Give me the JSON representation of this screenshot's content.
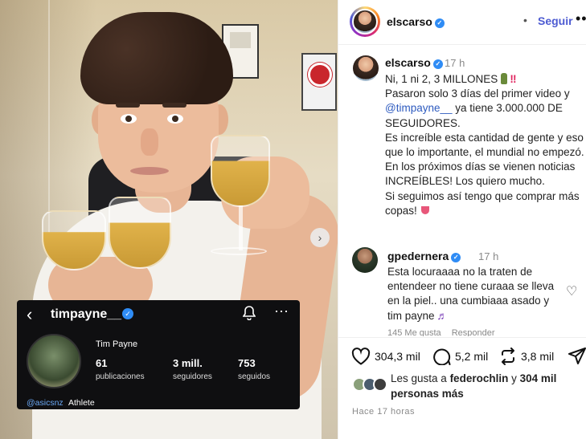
{
  "header": {
    "username": "elscarso",
    "follow_label": "Seguir",
    "more_label": "•••",
    "dot": "•"
  },
  "caption": {
    "username": "elscarso",
    "time": "17 h",
    "line1": "Ni, 1 ni 2, 3 MILLONES",
    "line2": "Pasaron solo 3 días del primer video y",
    "mention": "@timpayne__",
    "line3_rest": " ya tiene 3.000.000 DE SEGUIDORES.",
    "line4": "Es increíble esta cantidad de gente y eso que lo importante, el mundial no empezó.",
    "line5": "En los próximos días se vienen noticias INCREÍBLES! Los quiero mucho.",
    "line6": "Si seguimos así tengo que comprar más copas!"
  },
  "comment": {
    "username": "gpedernera",
    "time": "17 h",
    "text": "Esta locuraaaa no la traten de entendeer no tiene curaaa se lleva en la piel.. una cumbiaaa asado y tim payne",
    "likes": "145 Me gusta",
    "reply": "Responder"
  },
  "actions": {
    "likes_count": "304,3 mil",
    "comments_count": "5,2 mil",
    "shares_count": "3,8 mil"
  },
  "likes": {
    "prefix": "Les gusta a ",
    "user": "federochlin",
    "middle": " y ",
    "others": "304 mil personas más"
  },
  "posted": "Hace 17 horas",
  "media_card": {
    "handle": "timpayne__",
    "name": "Tim Payne",
    "posts": "61",
    "posts_label": "publicaciones",
    "followers": "3 mill.",
    "followers_label": "seguidores",
    "following": "753",
    "following_label": "seguidos",
    "link": "@asicsnz",
    "link_suffix": "Athlete"
  },
  "icons": {
    "back": "‹",
    "next": "›",
    "heart": "♡",
    "note": "♬"
  },
  "colors": {
    "accent_blue": "#2f8cf5",
    "follow_text": "#4d5bd2",
    "mention": "#2e5bbf"
  }
}
